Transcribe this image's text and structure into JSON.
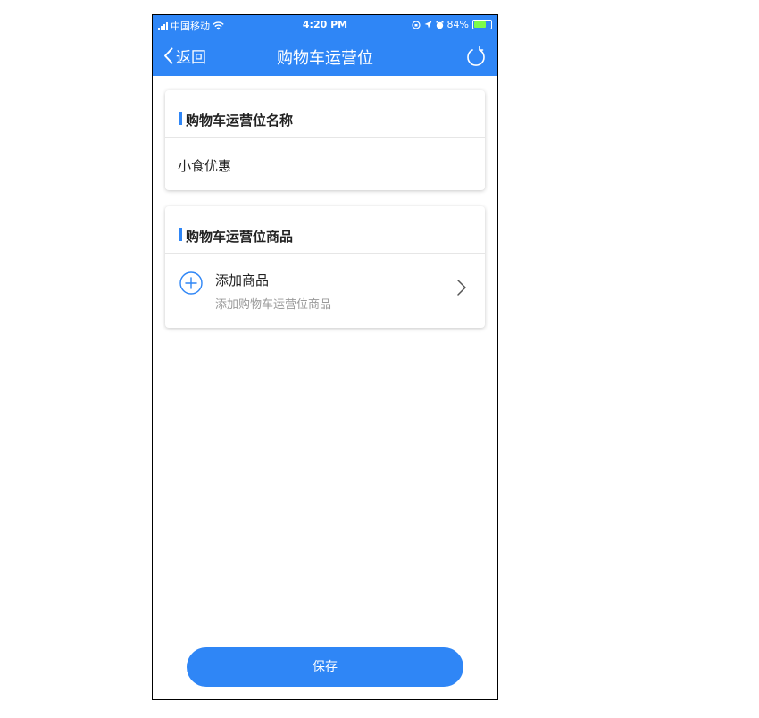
{
  "status_bar": {
    "carrier": "中国移动",
    "time": "4:20 PM",
    "battery": "84%",
    "battery_level": 0.84,
    "icons": [
      "signal-icon",
      "wifi-icon",
      "rotation-lock-icon",
      "location-icon",
      "alarm-icon",
      "battery-icon"
    ]
  },
  "nav": {
    "back_label": "返回",
    "title": "购物车运营位",
    "refresh_icon": "refresh-icon"
  },
  "name_section": {
    "title": "购物车运营位名称",
    "value": "小食优惠"
  },
  "goods_section": {
    "title": "购物车运营位商品",
    "add_title": "添加商品",
    "add_subtitle": "添加购物车运营位商品"
  },
  "save_label": "保存",
  "colors": {
    "primary": "#2f86f6",
    "text": "#222222",
    "muted": "#9a9a9a"
  }
}
